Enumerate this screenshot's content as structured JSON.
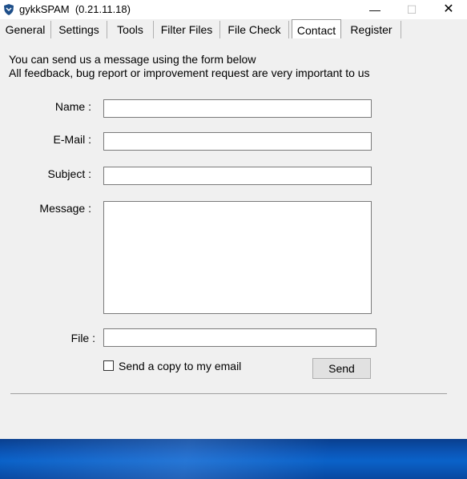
{
  "window": {
    "title": "gykkSPAM  (0.21.11.18)",
    "minimize_glyph": "—",
    "maximize_glyph": "☐",
    "close_glyph": "✕"
  },
  "tabs": [
    {
      "label": "General"
    },
    {
      "label": "Settings"
    },
    {
      "label": "Tools"
    },
    {
      "label": "Filter Files"
    },
    {
      "label": "File Check"
    },
    {
      "label": "Contact"
    },
    {
      "label": "Register"
    }
  ],
  "active_tab": "Contact",
  "intro": {
    "line1": "You can send us a message using the form below",
    "line2": "All feedback, bug report or improvement request are very important to us"
  },
  "form": {
    "name_label": "Name :",
    "name_value": "",
    "email_label": "E-Mail :",
    "email_value": "",
    "subject_label": "Subject :",
    "subject_value": "",
    "message_label": "Message :",
    "message_value": "",
    "file_label": "File :",
    "file_value": "",
    "copy_label": "Send a copy to my email",
    "copy_checked": false,
    "send_label": "Send"
  },
  "colors": {
    "background": "#f0f0f0",
    "taskbar": "#0b56b8"
  }
}
